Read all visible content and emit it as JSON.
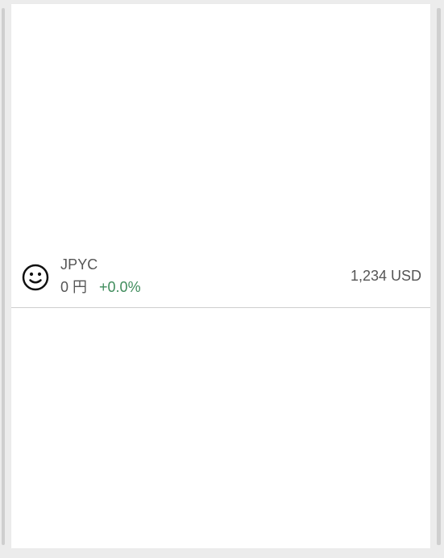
{
  "token": {
    "icon": "smiley-icon",
    "symbol": "JPYC",
    "balance": "0 円",
    "change": "+0.0%",
    "value": "1,234 USD"
  },
  "colors": {
    "background": "#ececec",
    "panel": "#ffffff",
    "text": "#555555",
    "positive": "#3f8c5c",
    "divider": "#cfcfcf"
  }
}
